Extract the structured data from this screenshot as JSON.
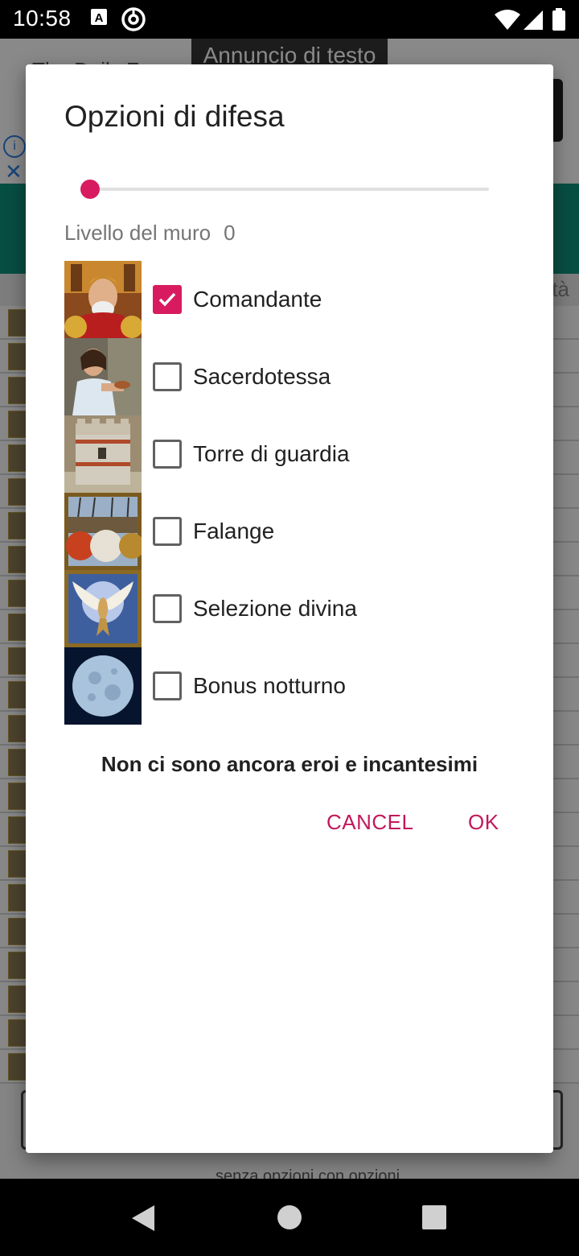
{
  "status_bar": {
    "time": "10:58"
  },
  "background": {
    "ad_label": "Annuncio di testo",
    "ad_title": "The Daily Fx",
    "header_text": "tà",
    "bottom_text": "senza opzioni   con opzioni"
  },
  "dialog": {
    "title": "Opzioni di difesa",
    "slider_value": 0,
    "wall_label": "Livello del muro",
    "wall_value": "0",
    "options": [
      {
        "label": "Comandante",
        "checked": true
      },
      {
        "label": "Sacerdotessa",
        "checked": false
      },
      {
        "label": "Torre di guardia",
        "checked": false
      },
      {
        "label": "Falange",
        "checked": false
      },
      {
        "label": "Selezione divina",
        "checked": false
      },
      {
        "label": "Bonus notturno",
        "checked": false
      }
    ],
    "note": "Non ci sono ancora eroi e incantesimi",
    "cancel_label": "CANCEL",
    "ok_label": "OK"
  },
  "colors": {
    "accent": "#d81b60",
    "button_text": "#c2185b"
  }
}
